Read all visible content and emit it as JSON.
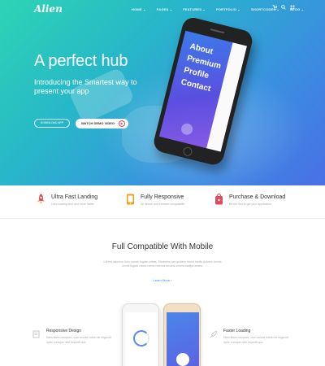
{
  "brand": {
    "logo": "Alien"
  },
  "nav": {
    "items": [
      "HOME ⌄",
      "PAGES ⌄",
      "FEATURES ⌄",
      "PORTFOLIO ⌄",
      "SHORTCODES ⌄",
      "BLOG ⌄"
    ],
    "icons": [
      "cart-icon",
      "search-icon",
      "grid-icon"
    ]
  },
  "hero": {
    "title": "A perfect hub",
    "subtitle": "Introducing the Smartest way to present your app",
    "download_label": "DOWNLOAD APP",
    "watch_label": "WATCH DEMO VIDEO",
    "phone_menu": [
      "About",
      "Premium",
      "Profile",
      "Contact"
    ]
  },
  "features": [
    {
      "title": "Ultra Fast Landing",
      "desc": "Less loading time and more faster",
      "icon": "rocket-icon",
      "color": "#e04a5f"
    },
    {
      "title": "Fully Responsive",
      "desc": "All device and browser compatable",
      "icon": "phone-icon",
      "color": "#f39c12"
    },
    {
      "title": "Purchase & Download",
      "desc": "Be the first to get your application",
      "icon": "bag-icon",
      "color": "#e04a5f"
    }
  ],
  "compat": {
    "title": "Full Compatible With Mobile",
    "desc": "Lid est laborum dolo rumes fugats untras. Etharums ser quidem rerum facilis dolores nemis omnis fugats vitaes nemo minima rerums unsers sadips amets.",
    "link": "Learn More ›"
  },
  "bottom_features": [
    {
      "title": "Responsive Design",
      "desc": "Nam libero tempore, cum soluta nobis est eligendi optio cumque nihil impedit quo",
      "icon": "page-icon"
    },
    {
      "title": "Faster Loading",
      "desc": "Nam libero tempore, cum soluta nobis est eligendi optio cumque nihil impedit quo",
      "icon": "rocket-icon"
    }
  ],
  "colors": {
    "accent": "#e04a5f",
    "link": "#3a8fe0"
  }
}
